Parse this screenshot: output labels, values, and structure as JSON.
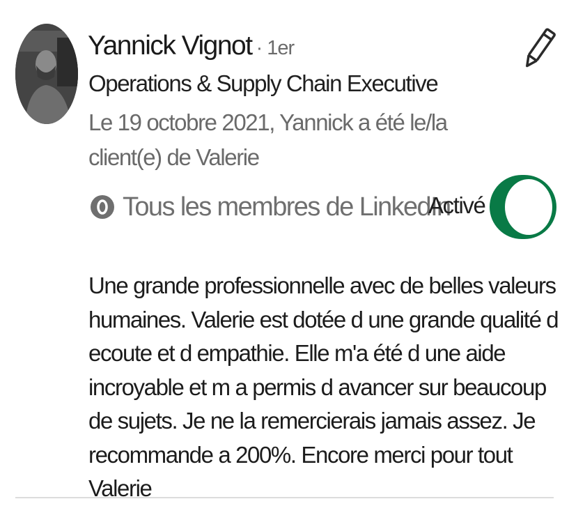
{
  "profile": {
    "name": "Yannick Vignot",
    "degree": "· 1er",
    "headline": "Operations & Supply Chain Executive",
    "relation": "Le 19 octobre 2021, Yannick a été le/la client(e) de Valerie"
  },
  "visibility": {
    "icon": "visibility-icon",
    "label": "Tous les membres de LinkedIn"
  },
  "toggle": {
    "label": "Activé",
    "state": "on",
    "color": "#097a46"
  },
  "recommendation": {
    "text": "Une grande professionnelle avec de belles valeurs humaines. Valerie est dotée d une grande qualité d ecoute et d empathie. Elle m'a été d une aide incroyable et m a permis d avancer sur beaucoup de sujets. Je ne la remercierais jamais assez. Je recommande a 200%. Encore merci pour tout Valerie"
  },
  "edit": {
    "icon": "pencil-icon"
  }
}
